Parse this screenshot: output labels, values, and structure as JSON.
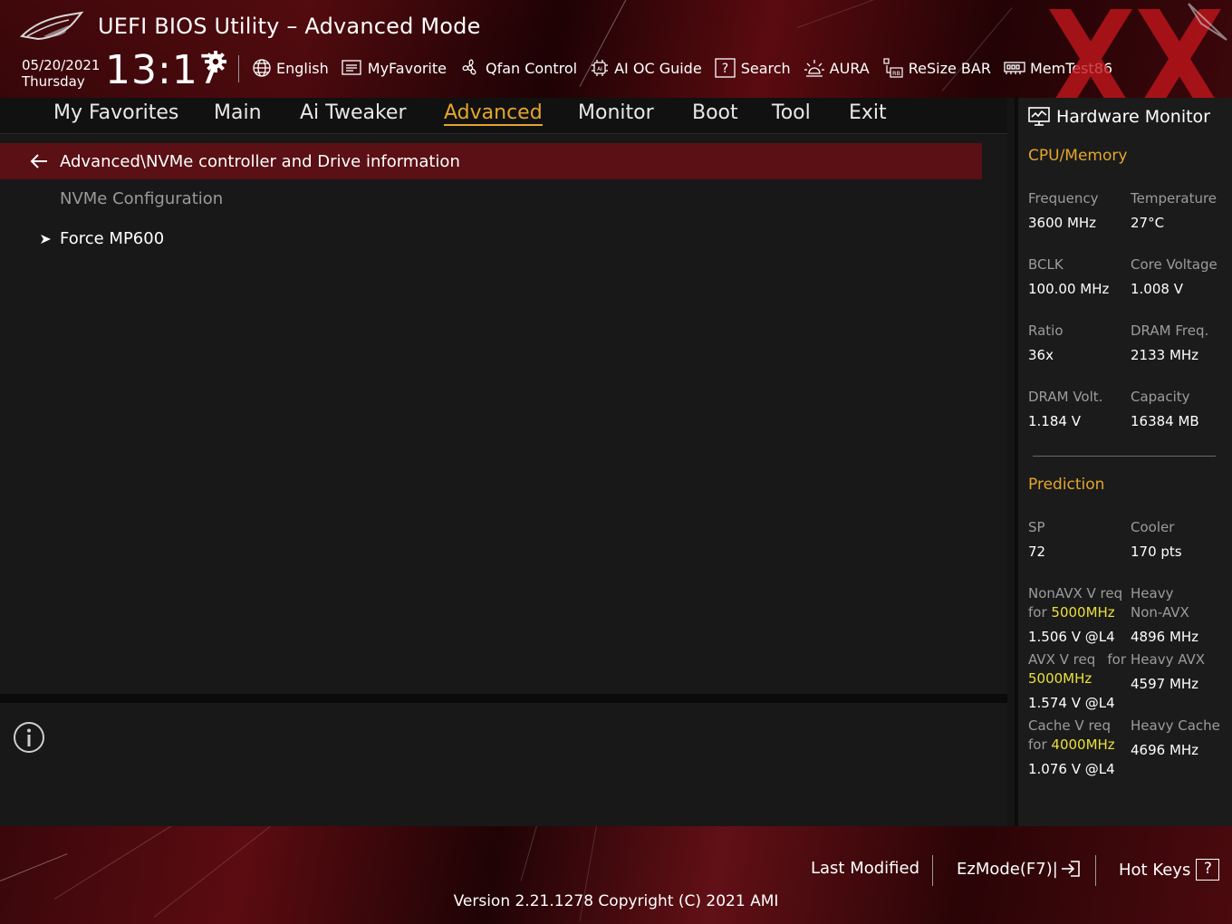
{
  "header": {
    "title": "UEFI BIOS Utility – Advanced Mode",
    "date": "05/20/2021",
    "weekday": "Thursday",
    "time": "13:17"
  },
  "toolbar": {
    "items": [
      {
        "label": "English",
        "icon": "globe-icon"
      },
      {
        "label": "MyFavorite",
        "icon": "favorite-list-icon"
      },
      {
        "label": "Qfan Control",
        "icon": "fan-icon"
      },
      {
        "label": "AI OC Guide",
        "icon": "ai-chip-icon"
      },
      {
        "label": "Search",
        "icon": "question-box-icon"
      },
      {
        "label": "AURA",
        "icon": "aura-light-icon"
      },
      {
        "label": "ReSize BAR",
        "icon": "resize-bar-icon"
      },
      {
        "label": "MemTest86",
        "icon": "memory-icon"
      }
    ]
  },
  "tabs": [
    "My Favorites",
    "Main",
    "Ai Tweaker",
    "Advanced",
    "Monitor",
    "Boot",
    "Tool",
    "Exit"
  ],
  "active_tab": "Advanced",
  "main": {
    "breadcrumb": "Advanced\\NVMe controller and Drive information",
    "section_label": "NVMe Configuration",
    "entries": [
      "Force MP600"
    ]
  },
  "hardware_monitor": {
    "title": "Hardware Monitor",
    "cpu_memory": {
      "heading": "CPU/Memory",
      "frequency_label": "Frequency",
      "frequency": "3600 MHz",
      "temperature_label": "Temperature",
      "temperature": "27°C",
      "bclk_label": "BCLK",
      "bclk": "100.00 MHz",
      "core_voltage_label": "Core Voltage",
      "core_voltage": "1.008 V",
      "ratio_label": "Ratio",
      "ratio": "36x",
      "dram_freq_label": "DRAM Freq.",
      "dram_freq": "2133 MHz",
      "dram_volt_label": "DRAM Volt.",
      "dram_volt": "1.184 V",
      "capacity_label": "Capacity",
      "capacity": "16384 MB"
    },
    "prediction": {
      "heading": "Prediction",
      "sp_label": "SP",
      "sp": "72",
      "cooler_label": "Cooler",
      "cooler": "170 pts",
      "nonavx_label_1": "NonAVX V req",
      "nonavx_label_for": "for ",
      "nonavx_freq": "5000MHz",
      "nonavx_value": "1.506 V @L4",
      "heavy_nonavx_label_1": "Heavy",
      "heavy_nonavx_label_2": "Non-AVX",
      "heavy_nonavx_value": "4896 MHz",
      "avx_label_1": "AVX V req",
      "avx_label_for": "for",
      "avx_freq": "5000MHz",
      "avx_value": "1.574 V @L4",
      "heavy_avx_label": "Heavy AVX",
      "heavy_avx_value": "4597 MHz",
      "cache_label_1": "Cache V req",
      "cache_label_for": "for ",
      "cache_freq": "4000MHz",
      "cache_value": "1.076 V @L4",
      "heavy_cache_label": "Heavy Cache",
      "heavy_cache_value": "4696 MHz"
    }
  },
  "footer": {
    "last_modified": "Last Modified",
    "ezmode": "EzMode(F7)|",
    "hot_keys": "Hot Keys",
    "hot_keys_glyph": "?",
    "version": "Version 2.21.1278 Copyright (C) 2021 AMI"
  },
  "colors": {
    "accent": "#e4a62c",
    "highlight": "#e8e03a",
    "breadcrumb_bg": "#5a1014"
  }
}
